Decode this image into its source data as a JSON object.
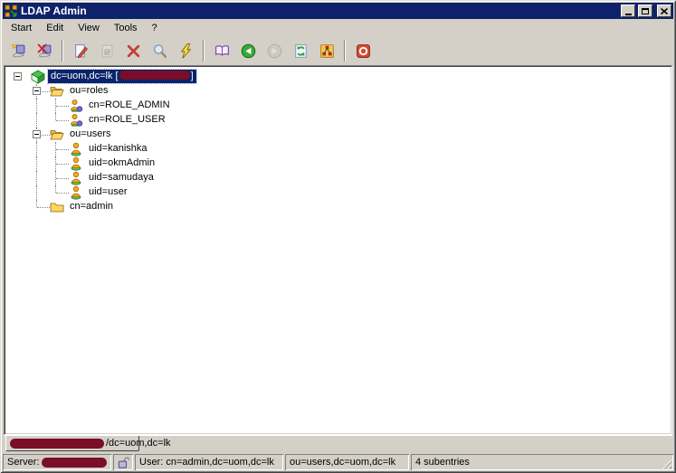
{
  "window": {
    "title": "LDAP Admin"
  },
  "menu": {
    "items": [
      "Start",
      "Edit",
      "View",
      "Tools",
      "?"
    ]
  },
  "toolbar": {
    "items": [
      {
        "type": "button",
        "name": "connect",
        "icon": "connect-icon"
      },
      {
        "type": "button",
        "name": "disconnect",
        "icon": "disconnect-icon"
      },
      {
        "type": "separator"
      },
      {
        "type": "button",
        "name": "edit-entry",
        "icon": "edit-icon"
      },
      {
        "type": "button",
        "name": "save",
        "icon": "save-icon",
        "disabled": true
      },
      {
        "type": "button",
        "name": "delete",
        "icon": "delete-icon"
      },
      {
        "type": "button",
        "name": "search",
        "icon": "search-icon"
      },
      {
        "type": "button",
        "name": "quick-modify",
        "icon": "lightning-icon"
      },
      {
        "type": "separator"
      },
      {
        "type": "button",
        "name": "schema",
        "icon": "book-icon"
      },
      {
        "type": "button",
        "name": "back",
        "icon": "back-icon"
      },
      {
        "type": "button",
        "name": "forward",
        "icon": "forward-icon",
        "disabled": true
      },
      {
        "type": "button",
        "name": "refresh",
        "icon": "refresh-icon"
      },
      {
        "type": "button",
        "name": "directory-tree",
        "icon": "tree-icon"
      },
      {
        "type": "separator"
      },
      {
        "type": "button",
        "name": "exit",
        "icon": "power-icon"
      }
    ]
  },
  "tree": {
    "items": [
      {
        "depth": 0,
        "icon": "root-icon",
        "label": "dc=uom,dc=lk [",
        "redaction": true,
        "suffix": "]",
        "selected": true,
        "expander": "minus",
        "id": "root"
      },
      {
        "depth": 1,
        "icon": "folder-open-icon",
        "label": "ou=roles",
        "expander": "minus",
        "id": "ou-roles"
      },
      {
        "depth": 2,
        "icon": "role-icon",
        "label": "cn=ROLE_ADMIN",
        "id": "role-admin"
      },
      {
        "depth": 2,
        "icon": "role-icon",
        "label": "cn=ROLE_USER",
        "id": "role-user"
      },
      {
        "depth": 1,
        "icon": "folder-open-icon",
        "label": "ou=users",
        "expander": "minus",
        "id": "ou-users"
      },
      {
        "depth": 2,
        "icon": "user-icon",
        "label": "uid=kanishka",
        "id": "uid-kanishka"
      },
      {
        "depth": 2,
        "icon": "user-icon",
        "label": "uid=okmAdmin",
        "id": "uid-okmadmin"
      },
      {
        "depth": 2,
        "icon": "user-icon",
        "label": "uid=samudaya",
        "id": "uid-samudaya"
      },
      {
        "depth": 2,
        "icon": "user-icon",
        "label": "uid=user",
        "id": "uid-user"
      },
      {
        "depth": 1,
        "icon": "folder-closed-icon",
        "label": "cn=admin",
        "id": "cn-admin"
      }
    ]
  },
  "tabs": {
    "items": [
      {
        "redaction": true,
        "label": "/dc=uom,dc=lk",
        "active": true
      }
    ]
  },
  "statusbar": {
    "panels": [
      {
        "name": "server-panel",
        "label": "Server:",
        "redaction": true
      },
      {
        "name": "lock-panel",
        "icon": "unlock-icon"
      },
      {
        "name": "user-panel",
        "text": "User: cn=admin,dc=uom,dc=lk"
      },
      {
        "name": "base-dn-panel",
        "text": "ou=users,dc=uom,dc=lk"
      },
      {
        "name": "subentries-panel",
        "text": "4 subentries"
      }
    ]
  },
  "colors": {
    "titlebar": "#0e226b",
    "selection": "#0a246a",
    "redaction": "#7a0d28",
    "chrome": "#d4d0c8"
  }
}
